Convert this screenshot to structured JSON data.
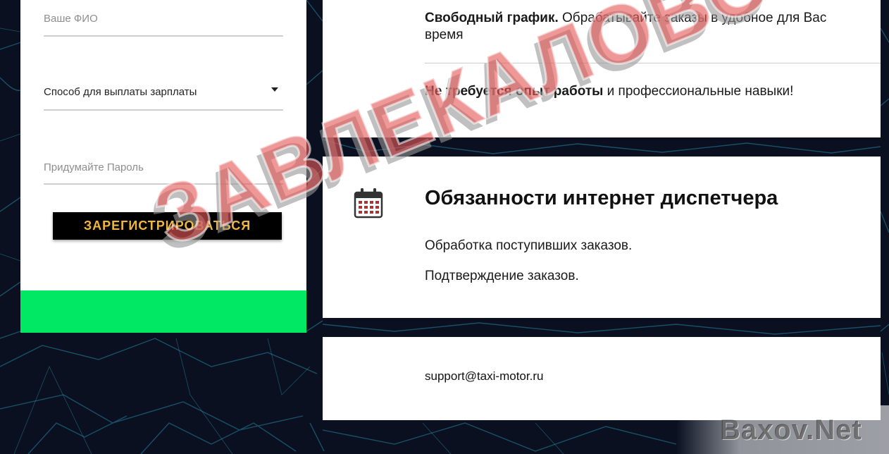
{
  "registration": {
    "fullname_placeholder": "Ваше ФИО",
    "payout_select_value": "Способ для выплаты зарплаты",
    "password_placeholder": "Придумайте Пароль",
    "register_button": "ЗАРЕГИСТРИРОВАТЬСЯ"
  },
  "benefits": {
    "item1_bold": "Свободный график.",
    "item1_text": " Обрабатывайте заказы в удобное для Вас время",
    "item2_bold": "Не требуется опыт работы",
    "item2_text": " и профессиональные навыки!"
  },
  "duties": {
    "icon": "calendar-icon",
    "title": "Обязанности интернет диспетчера",
    "items": [
      "Обработка поступивших заказов.",
      "Подтверждение заказов."
    ]
  },
  "contact": {
    "email": "support@taxi-motor.ru"
  },
  "watermarks": {
    "stamp": "ЗАВЛЕКАЛОВО",
    "site": "Baxov.Net"
  },
  "colors": {
    "accent_button_text": "#f2b63c",
    "green_bar": "#00e864",
    "background": "#0a1020"
  }
}
